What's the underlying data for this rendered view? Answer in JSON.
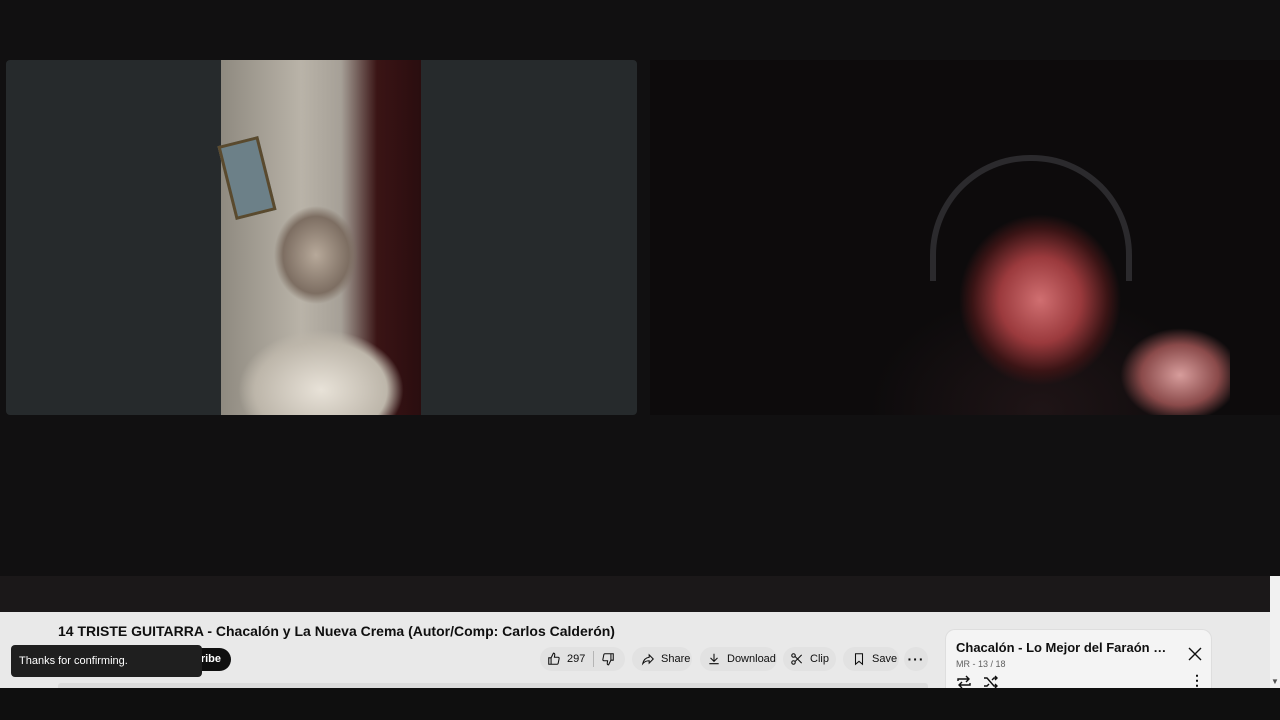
{
  "video": {
    "title": "14 TRISTE GUITARRA - Chacalón y La Nueva Crema (Autor/Comp: Carlos Calderón)"
  },
  "channel": {
    "subscribe_label": "Subscribe",
    "subscribe_visible_text": "cribe"
  },
  "toast": {
    "message": "Thanks for confirming."
  },
  "actions": {
    "like_count": "297",
    "share_label": "Share",
    "download_label": "Download",
    "clip_label": "Clip",
    "save_label": "Save",
    "more_label": "···"
  },
  "playlist": {
    "title": "Chacalón - Lo Mejor del Faraón de l...",
    "meta": "MR - 13 / 18"
  },
  "icons": {
    "like": "thumbs-up-icon",
    "dislike": "thumbs-down-icon",
    "share": "share-icon",
    "download": "download-icon",
    "clip": "scissors-icon",
    "save": "bookmark-icon",
    "close": "close-icon",
    "loop": "loop-icon",
    "shuffle": "shuffle-icon"
  },
  "colors": {
    "page_bg": "#0f0f0f",
    "info_bg": "#e9e9e9",
    "pill_bg": "#e2e2e2",
    "toast_bg": "#1f1f1f"
  }
}
